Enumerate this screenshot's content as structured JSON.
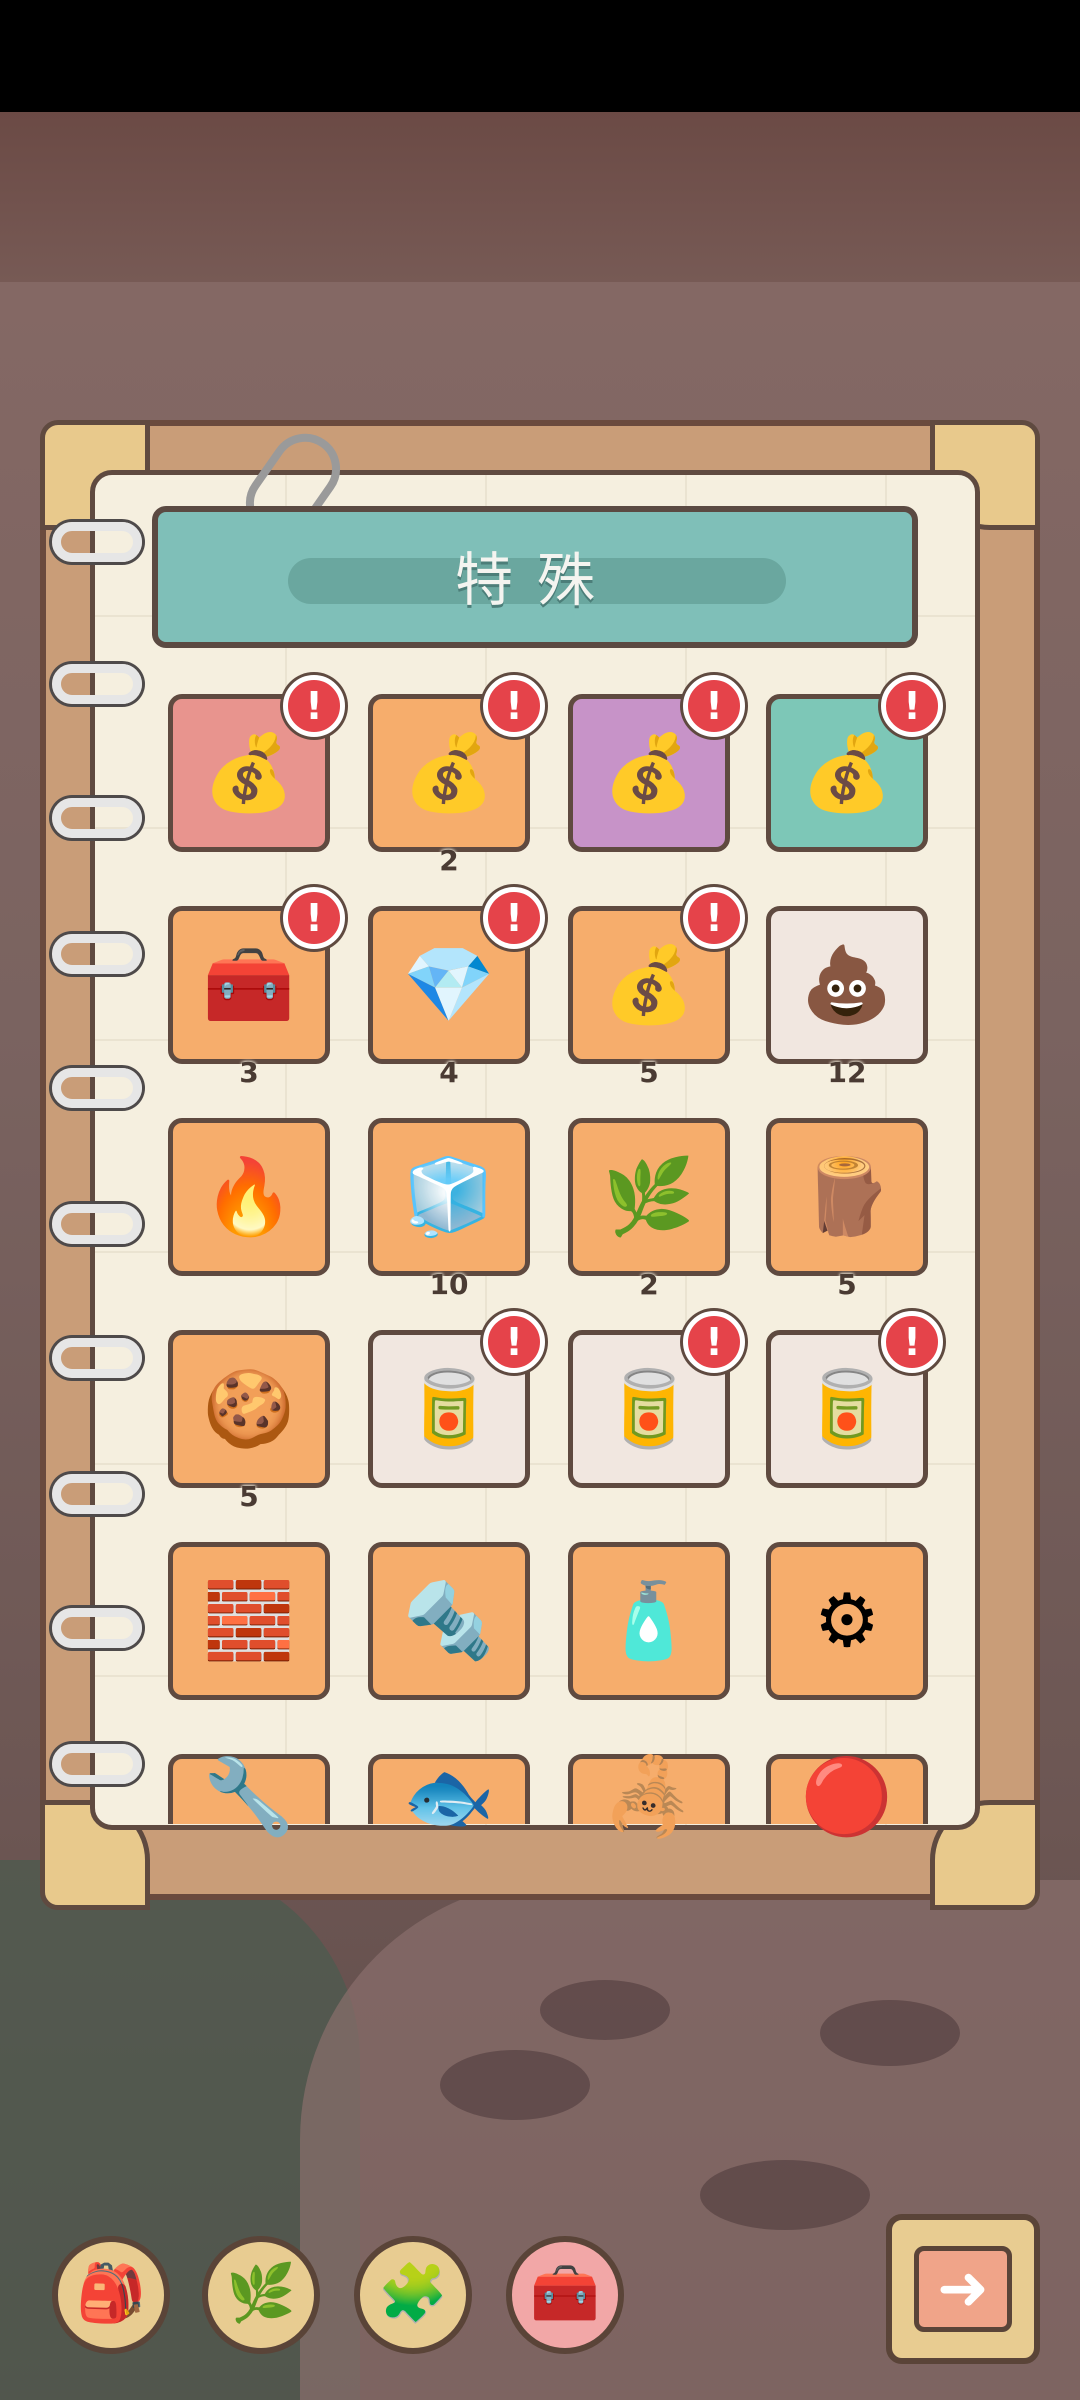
{
  "page": {
    "title": "特殊"
  },
  "items": [
    {
      "id": "lucky-bag-red",
      "icon": "lucky-bag-icon",
      "bg": "#e8948e",
      "count": "",
      "badge": "!"
    },
    {
      "id": "lucky-bag-orange",
      "icon": "lucky-bag-icon",
      "bg": "#f6ad6c",
      "count": "2",
      "badge": "!"
    },
    {
      "id": "lucky-bag-purple",
      "icon": "lucky-bag-icon",
      "bg": "#c793c8",
      "count": "",
      "badge": "!"
    },
    {
      "id": "lucky-bag-teal",
      "icon": "lucky-bag-icon",
      "bg": "#7dc7b7",
      "count": "",
      "badge": "!"
    },
    {
      "id": "treasure-chest",
      "icon": "treasure-chest-icon",
      "bg": "#f6ad6c",
      "count": "3",
      "badge": "!"
    },
    {
      "id": "gem-sack",
      "icon": "gem-sack-icon",
      "bg": "#f6ad6c",
      "count": "4",
      "badge": "!"
    },
    {
      "id": "lucky-bag-blue",
      "icon": "lucky-bag-icon",
      "bg": "#f6ad6c",
      "count": "5",
      "badge": "!"
    },
    {
      "id": "poop",
      "icon": "poop-icon",
      "bg": "#f1e7e0",
      "count": "12",
      "badge": ""
    },
    {
      "id": "fire-emblem",
      "icon": "fire-emblem-icon",
      "bg": "#f6ad6c",
      "count": "",
      "badge": ""
    },
    {
      "id": "ice-crystal",
      "icon": "ice-crystal-icon",
      "bg": "#f6ad6c",
      "count": "10",
      "badge": ""
    },
    {
      "id": "root-branch",
      "icon": "root-branch-icon",
      "bg": "#f6ad6c",
      "count": "2",
      "badge": ""
    },
    {
      "id": "wet-wood",
      "icon": "wet-wood-icon",
      "bg": "#f6ad6c",
      "count": "5",
      "badge": ""
    },
    {
      "id": "snack-bag",
      "icon": "snack-bag-icon",
      "bg": "#f6ad6c",
      "count": "5",
      "badge": ""
    },
    {
      "id": "can-blue",
      "icon": "canned-food-icon",
      "bg": "#f1e7e0",
      "count": "",
      "badge": "!"
    },
    {
      "id": "can-purple",
      "icon": "canned-food-icon",
      "bg": "#f1e7e0",
      "count": "",
      "badge": "!"
    },
    {
      "id": "can-red",
      "icon": "canned-food-icon",
      "bg": "#f1e7e0",
      "count": "",
      "badge": "!"
    },
    {
      "id": "metal-block",
      "icon": "metal-block-icon",
      "bg": "#f6ad6c",
      "count": "",
      "badge": ""
    },
    {
      "id": "metal-pipe",
      "icon": "metal-pipe-icon",
      "bg": "#f6ad6c",
      "count": "",
      "badge": ""
    },
    {
      "id": "spray-can",
      "icon": "spray-can-icon",
      "bg": "#f6ad6c",
      "count": "",
      "badge": ""
    },
    {
      "id": "machine-part",
      "icon": "machine-part-icon",
      "bg": "#f6ad6c",
      "count": "",
      "badge": ""
    },
    {
      "id": "gear-part",
      "icon": "gear-part-icon",
      "bg": "#f6ad6c",
      "count": "",
      "badge": ""
    },
    {
      "id": "red-fish",
      "icon": "fish-icon",
      "bg": "#f6ad6c",
      "count": "",
      "badge": ""
    },
    {
      "id": "scorpion",
      "icon": "scorpion-icon",
      "bg": "#f6ad6c",
      "count": "",
      "badge": ""
    },
    {
      "id": "red-orb",
      "icon": "red-orb-icon",
      "bg": "#f6ad6c",
      "count": "",
      "badge": ""
    }
  ],
  "bottom_nav": [
    {
      "id": "backpack",
      "icon": "backpack-icon",
      "active": false
    },
    {
      "id": "plants",
      "icon": "plant-branch-icon",
      "active": false
    },
    {
      "id": "puzzle",
      "icon": "puzzle-piece-icon",
      "active": false
    },
    {
      "id": "chest",
      "icon": "treasure-chest-icon",
      "active": true
    }
  ],
  "next_button": {
    "icon": "arrow-right-icon"
  }
}
